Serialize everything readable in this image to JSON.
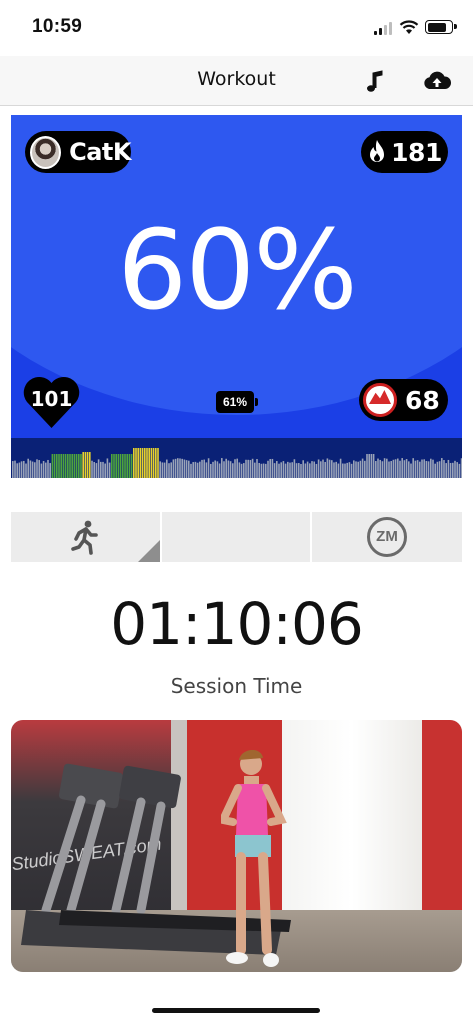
{
  "status_bar": {
    "time": "10:59",
    "battery_level": 0.8,
    "signal_bars_on": 2
  },
  "nav": {
    "title": "Workout",
    "music_icon": "music-note-icon",
    "upload_icon": "cloud-upload-icon"
  },
  "hero": {
    "user_name": "CatK",
    "calories": "181",
    "effort_percent": "60%",
    "heart_rate": "101",
    "sensor_battery": "61%",
    "meps_points": "68",
    "background_color": "#1b3fe6",
    "effort_graph": {
      "zone_colors": {
        "grey": "#9aa3b8",
        "green": "#4ea53c",
        "yellow": "#e8d32b"
      }
    }
  },
  "controls": {
    "activity_icon": "running-person-icon",
    "zm_label": "ZM"
  },
  "timer": {
    "value": "01:10:06",
    "label": "Session Time"
  },
  "video": {
    "brand_text": "StudioSWEAT.com"
  }
}
